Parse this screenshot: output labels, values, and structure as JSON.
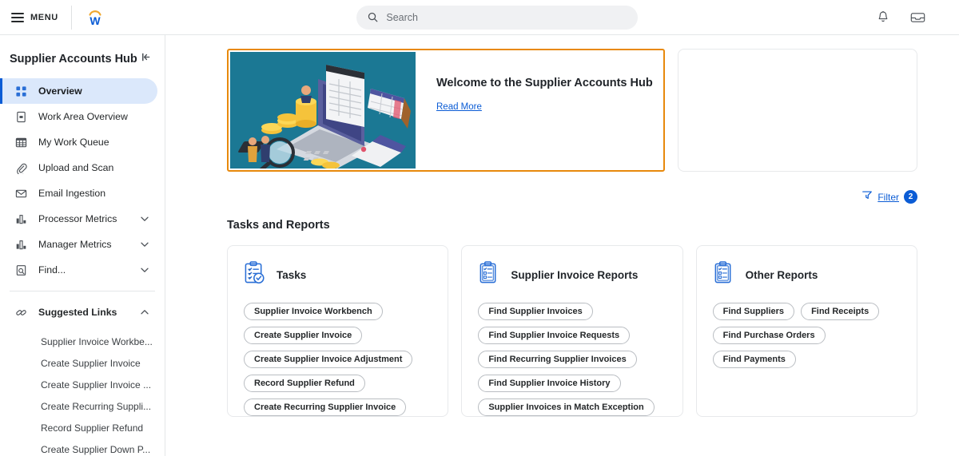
{
  "topbar": {
    "menu_label": "MENU",
    "menu_icon": "hamburger-icon",
    "logo": "workday-logo",
    "search_placeholder": "Search",
    "search_value": "",
    "search_icon": "search-icon",
    "notifications_icon": "bell-icon",
    "inbox_icon": "inbox-tray-icon"
  },
  "sidebar": {
    "title": "Supplier Accounts Hub",
    "collapse_icon": "collapse-panel-icon",
    "items": [
      {
        "label": "Overview",
        "icon": "grid-squares-icon",
        "active": true,
        "expandable": false
      },
      {
        "label": "Work Area Overview",
        "icon": "document-panel-icon",
        "active": false,
        "expandable": false
      },
      {
        "label": "My Work Queue",
        "icon": "table-grid-icon",
        "active": false,
        "expandable": false
      },
      {
        "label": "Upload and Scan",
        "icon": "paperclip-icon",
        "active": false,
        "expandable": false
      },
      {
        "label": "Email Ingestion",
        "icon": "envelope-icon",
        "active": false,
        "expandable": false
      },
      {
        "label": "Processor Metrics",
        "icon": "bar-chart-icon",
        "active": false,
        "expandable": true
      },
      {
        "label": "Manager Metrics",
        "icon": "bar-chart-icon",
        "active": false,
        "expandable": true
      },
      {
        "label": "Find...",
        "icon": "find-document-icon",
        "active": false,
        "expandable": true
      }
    ],
    "suggested": {
      "label": "Suggested Links",
      "icon": "chain-link-icon",
      "expanded": true,
      "links": [
        "Supplier Invoice Workbe...",
        "Create Supplier Invoice",
        "Create Supplier Invoice ...",
        "Create Recurring Suppli...",
        "Record Supplier Refund",
        "Create Supplier Down P..."
      ]
    }
  },
  "banner": {
    "title": "Welcome to the Supplier Accounts Hub",
    "read_more": "Read More",
    "image_alt": "accounts-payable-illustration",
    "image_label": "PAYABLE",
    "focus_color": "#e8890c",
    "image_bg": "#1b7894"
  },
  "filter": {
    "label": "Filter",
    "count": "2",
    "icon": "filter-funnel-icon",
    "accent": "#0b5cd5"
  },
  "main": {
    "section_title": "Tasks and Reports",
    "cards": [
      {
        "title": "Tasks",
        "icon": "clipboard-check-icon",
        "pills": [
          "Supplier Invoice Workbench",
          "Create Supplier Invoice",
          "Create Supplier Invoice Adjustment",
          "Record Supplier Refund",
          "Create Recurring Supplier Invoice"
        ]
      },
      {
        "title": "Supplier Invoice Reports",
        "icon": "clipboard-list-icon",
        "pills": [
          "Find Supplier Invoices",
          "Find Supplier Invoice Requests",
          "Find Recurring Supplier Invoices",
          "Find Supplier Invoice History",
          "Supplier Invoices in Match Exception"
        ]
      },
      {
        "title": "Other Reports",
        "icon": "clipboard-list-icon",
        "pills": [
          "Find Suppliers",
          "Find Receipts",
          "Find Purchase Orders",
          "Find Payments"
        ]
      }
    ]
  }
}
